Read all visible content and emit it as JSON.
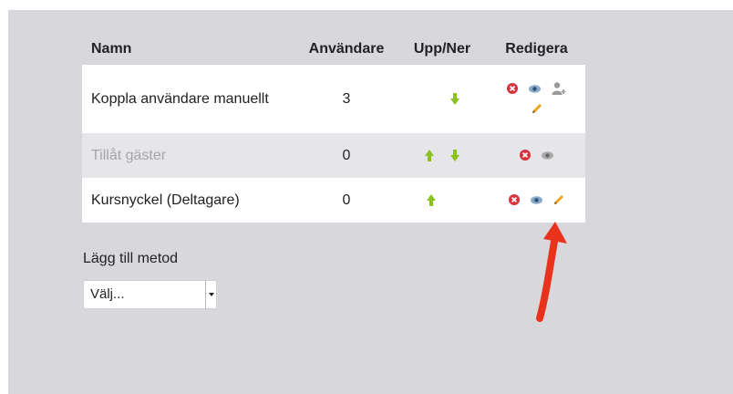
{
  "table": {
    "headers": {
      "name": "Namn",
      "users": "Användare",
      "updown": "Upp/Ner",
      "edit": "Redigera"
    },
    "rows": [
      {
        "name": "Koppla användare manuellt",
        "users": "3",
        "enabled": true,
        "icons": [
          "arrow-down-icon",
          "delete-icon",
          "eye-icon",
          "assign-user-icon",
          "edit-pencil-icon"
        ]
      },
      {
        "name": "Tillåt gäster",
        "users": "0",
        "enabled": false,
        "icons": [
          "arrow-up-icon",
          "arrow-down-icon",
          "delete-icon",
          "eye-icon"
        ]
      },
      {
        "name": "Kursnyckel (Deltagare)",
        "users": "0",
        "enabled": true,
        "icons": [
          "arrow-up-icon",
          "delete-icon",
          "eye-icon",
          "edit-pencil-icon"
        ]
      }
    ]
  },
  "add_method": {
    "label": "Lägg till metod",
    "select_value": "Välj..."
  },
  "colors": {
    "panel_bg": "#d8d7dc",
    "row_grey": "#e6e5e9",
    "arrow_green": "#8bc21a",
    "delete_red": "#d9323c",
    "pencil_orange": "#f3a31a",
    "annotation_red": "#e8321c",
    "muted_text": "#a6a6a6"
  }
}
